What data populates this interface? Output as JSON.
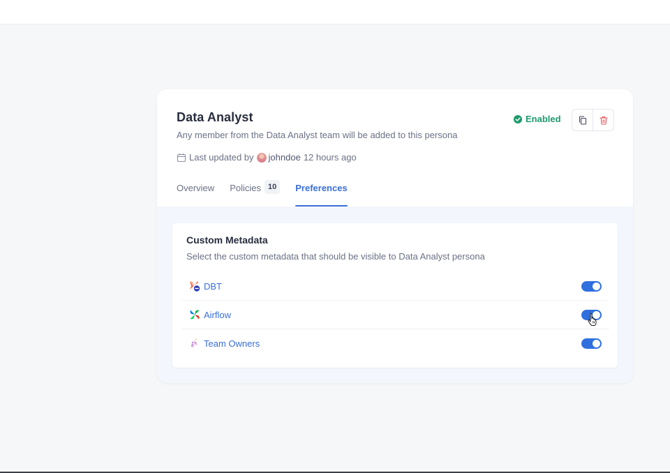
{
  "persona": {
    "title": "Data Analyst",
    "description": "Any member from the Data Analyst team will be added to this persona",
    "updated_prefix": "Last updated by",
    "updated_user": "johndoe",
    "updated_time": "12 hours ago",
    "status": "Enabled"
  },
  "tabs": [
    {
      "label": "Overview",
      "count": null,
      "active": false
    },
    {
      "label": "Policies",
      "count": "10",
      "active": false
    },
    {
      "label": "Preferences",
      "count": null,
      "active": true
    }
  ],
  "custom_metadata": {
    "title": "Custom Metadata",
    "description": "Select the custom metadata that should be visible to Data Analyst persona",
    "items": [
      {
        "label": "DBT",
        "icon": "dbt-icon",
        "enabled": true
      },
      {
        "label": "Airflow",
        "icon": "airflow-icon",
        "enabled": true
      },
      {
        "label": "Team Owners",
        "icon": "unicorn-icon",
        "enabled": true
      }
    ]
  },
  "colors": {
    "accent": "#3a6fd9",
    "toggle_on": "#2f6fde",
    "status_green": "#1d9a6c",
    "delete_red": "#e0565b"
  }
}
